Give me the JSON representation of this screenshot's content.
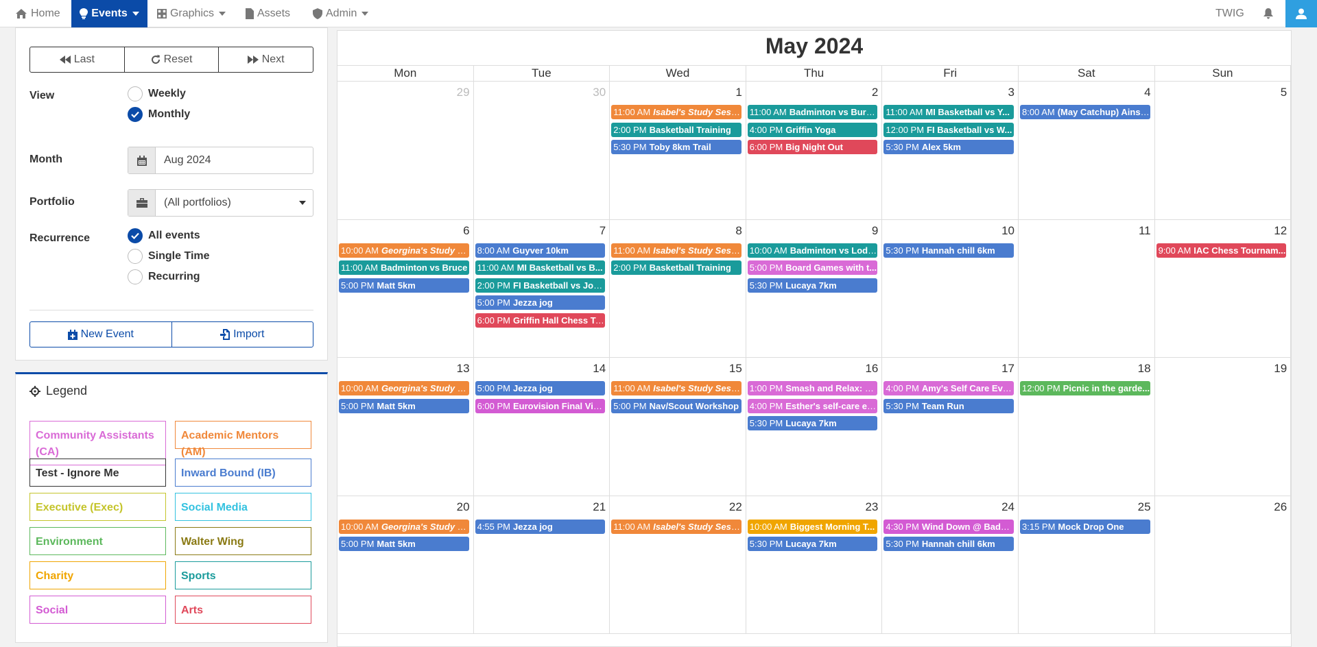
{
  "nav": {
    "items": [
      {
        "label": "Home",
        "icon": "home-icon"
      },
      {
        "label": "Events",
        "icon": "lightbulb-icon"
      },
      {
        "label": "Graphics",
        "icon": "graphics-icon"
      },
      {
        "label": "Assets",
        "icon": "file-icon"
      },
      {
        "label": "Admin",
        "icon": "shield-icon"
      }
    ],
    "org": "TWIG"
  },
  "filters": {
    "buttons": {
      "last": "Last",
      "reset": "Reset",
      "next": "Next"
    },
    "view_label": "View",
    "view_options": [
      "Weekly",
      "Monthly"
    ],
    "view_selected": "Monthly",
    "month_label": "Month",
    "month_value": "Aug 2024",
    "portfolio_label": "Portfolio",
    "portfolio_value": "(All portfolios)",
    "recurrence_label": "Recurrence",
    "recurrence_options": [
      "All events",
      "Single Time",
      "Recurring"
    ],
    "recurrence_selected": "All events",
    "new_event": "New Event",
    "import": "Import"
  },
  "legend": {
    "title": "Legend",
    "items": [
      {
        "label": "Community Assistants  (CA)",
        "color": "#d96ad6"
      },
      {
        "label": "Academic Mentors  (AM)",
        "color": "#f0883a"
      },
      {
        "label": "Test - Ignore Me",
        "color": "#333333"
      },
      {
        "label": "Inward Bound  (IB)",
        "color": "#4a7ccf"
      },
      {
        "label": "Executive  (Exec)",
        "color": "#c4c42a"
      },
      {
        "label": "Social Media",
        "color": "#33c2e0"
      },
      {
        "label": "Environment",
        "color": "#5cb85c"
      },
      {
        "label": "Walter Wing",
        "color": "#8a7a14"
      },
      {
        "label": "Charity",
        "color": "#f0a500"
      },
      {
        "label": "Sports",
        "color": "#1a9b9b"
      },
      {
        "label": "Social",
        "color": "#d35bd3"
      },
      {
        "label": "Arts",
        "color": "#e0485a"
      }
    ]
  },
  "calendar": {
    "title": "May 2024",
    "weekdays": [
      "Mon",
      "Tue",
      "Wed",
      "Thu",
      "Fri",
      "Sat",
      "Sun"
    ],
    "weeks": [
      [
        {
          "day": "29",
          "muted": true,
          "events": []
        },
        {
          "day": "30",
          "muted": true,
          "events": []
        },
        {
          "day": "1",
          "events": [
            {
              "time": "11:00 AM",
              "name": "Isabel's Study Sessi...",
              "color": "#f0883a",
              "italic": true
            },
            {
              "time": "2:00 PM",
              "name": "Basketball Training",
              "color": "#1a9b9b"
            },
            {
              "time": "5:30 PM",
              "name": "Toby 8km Trail",
              "color": "#4a7ccf"
            }
          ]
        },
        {
          "day": "2",
          "events": [
            {
              "time": "11:00 AM",
              "name": "Badminton vs Burg...",
              "color": "#1a9b9b"
            },
            {
              "time": "4:00 PM",
              "name": "Griffin Yoga",
              "color": "#1a9b9b"
            },
            {
              "time": "6:00 PM",
              "name": "Big Night Out",
              "color": "#e0485a"
            }
          ]
        },
        {
          "day": "3",
          "events": [
            {
              "time": "11:00 AM",
              "name": "MI Basketball vs Y...",
              "color": "#1a9b9b"
            },
            {
              "time": "12:00 PM",
              "name": "FI Basketball vs W...",
              "color": "#1a9b9b"
            },
            {
              "time": "5:30 PM",
              "name": "Alex 5km",
              "color": "#4a7ccf"
            }
          ]
        },
        {
          "day": "4",
          "events": [
            {
              "time": "8:00 AM",
              "name": "(May Catchup) Ainsl...",
              "color": "#4a7ccf"
            }
          ]
        },
        {
          "day": "5",
          "events": []
        }
      ],
      [
        {
          "day": "6",
          "events": [
            {
              "time": "10:00 AM",
              "name": "Georgina's Study S...",
              "color": "#f0883a",
              "italic": true
            },
            {
              "time": "11:00 AM",
              "name": "Badminton vs Bruce",
              "color": "#1a9b9b"
            },
            {
              "time": "5:00 PM",
              "name": "Matt 5km",
              "color": "#4a7ccf"
            }
          ]
        },
        {
          "day": "7",
          "events": [
            {
              "time": "8:00 AM",
              "name": "Guyver 10km",
              "color": "#4a7ccf"
            },
            {
              "time": "11:00 AM",
              "name": "MI Basketball vs B...",
              "color": "#1a9b9b"
            },
            {
              "time": "2:00 PM",
              "name": "FI Basketball vs Joh...",
              "color": "#1a9b9b"
            },
            {
              "time": "5:00 PM",
              "name": "Jezza jog",
              "color": "#4a7ccf"
            },
            {
              "time": "6:00 PM",
              "name": "Griffin Hall Chess To...",
              "color": "#e0485a"
            }
          ]
        },
        {
          "day": "8",
          "events": [
            {
              "time": "11:00 AM",
              "name": "Isabel's Study Sessi...",
              "color": "#f0883a",
              "italic": true
            },
            {
              "time": "2:00 PM",
              "name": "Basketball Training",
              "color": "#1a9b9b"
            }
          ]
        },
        {
          "day": "9",
          "events": [
            {
              "time": "10:00 AM",
              "name": "Badminton vs Lodge",
              "color": "#1a9b9b"
            },
            {
              "time": "5:00 PM",
              "name": "Board Games with t...",
              "color": "#d96ad6"
            },
            {
              "time": "5:30 PM",
              "name": "Lucaya 7km",
              "color": "#4a7ccf"
            }
          ]
        },
        {
          "day": "10",
          "events": [
            {
              "time": "5:30 PM",
              "name": "Hannah chill 6km",
              "color": "#4a7ccf"
            }
          ]
        },
        {
          "day": "11",
          "events": []
        },
        {
          "day": "12",
          "events": [
            {
              "time": "9:00 AM",
              "name": "IAC Chess Tournam...",
              "color": "#e0485a"
            }
          ]
        }
      ],
      [
        {
          "day": "13",
          "events": [
            {
              "time": "10:00 AM",
              "name": "Georgina's Study S...",
              "color": "#f0883a",
              "italic": true
            },
            {
              "time": "5:00 PM",
              "name": "Matt 5km",
              "color": "#4a7ccf"
            }
          ]
        },
        {
          "day": "14",
          "events": [
            {
              "time": "5:00 PM",
              "name": "Jezza jog",
              "color": "#4a7ccf"
            },
            {
              "time": "6:00 PM",
              "name": "Eurovision Final Vie...",
              "color": "#d35bd3"
            }
          ]
        },
        {
          "day": "15",
          "events": [
            {
              "time": "11:00 AM",
              "name": "Isabel's Study Sessi...",
              "color": "#f0883a",
              "italic": true
            },
            {
              "time": "5:00 PM",
              "name": "Nav/Scout Workshop",
              "color": "#4a7ccf"
            }
          ]
        },
        {
          "day": "16",
          "events": [
            {
              "time": "1:00 PM",
              "name": "Smash and Relax: U...",
              "color": "#d96ad6"
            },
            {
              "time": "4:00 PM",
              "name": "Esther's self-care ev...",
              "color": "#d96ad6"
            },
            {
              "time": "5:30 PM",
              "name": "Lucaya 7km",
              "color": "#4a7ccf"
            }
          ]
        },
        {
          "day": "17",
          "events": [
            {
              "time": "4:00 PM",
              "name": "Amy's Self Care Eve...",
              "color": "#d96ad6"
            },
            {
              "time": "5:30 PM",
              "name": "Team Run",
              "color": "#4a7ccf"
            }
          ]
        },
        {
          "day": "18",
          "events": [
            {
              "time": "12:00 PM",
              "name": "Picnic in the garde...",
              "color": "#5cb85c"
            }
          ]
        },
        {
          "day": "19",
          "events": []
        }
      ],
      [
        {
          "day": "20",
          "events": [
            {
              "time": "10:00 AM",
              "name": "Georgina's Study S...",
              "color": "#f0883a",
              "italic": true
            },
            {
              "time": "5:00 PM",
              "name": "Matt 5km",
              "color": "#4a7ccf"
            }
          ]
        },
        {
          "day": "21",
          "events": [
            {
              "time": "4:55 PM",
              "name": "Jezza jog",
              "color": "#4a7ccf"
            }
          ]
        },
        {
          "day": "22",
          "events": [
            {
              "time": "11:00 AM",
              "name": "Isabel's Study Sessi...",
              "color": "#f0883a",
              "italic": true
            }
          ]
        },
        {
          "day": "23",
          "events": [
            {
              "time": "10:00 AM",
              "name": "Biggest Morning T...",
              "color": "#f0a500"
            },
            {
              "time": "5:30 PM",
              "name": "Lucaya 7km",
              "color": "#4a7ccf"
            }
          ]
        },
        {
          "day": "24",
          "events": [
            {
              "time": "4:30 PM",
              "name": "Wind Down @ Badger",
              "color": "#d35bd3"
            },
            {
              "time": "5:30 PM",
              "name": "Hannah chill 6km",
              "color": "#4a7ccf"
            }
          ]
        },
        {
          "day": "25",
          "events": [
            {
              "time": "3:15 PM",
              "name": "Mock Drop One",
              "color": "#4a7ccf"
            }
          ]
        },
        {
          "day": "26",
          "events": []
        }
      ]
    ]
  }
}
